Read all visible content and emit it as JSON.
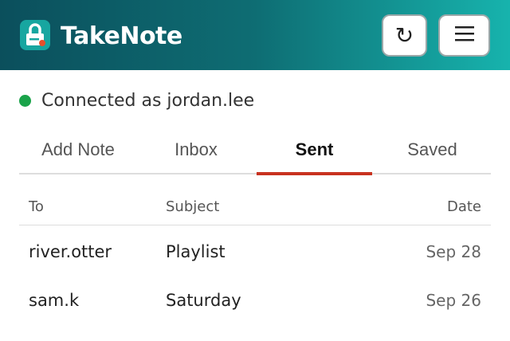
{
  "app": {
    "title": "TakeNote",
    "logo_icon": "lock-icon"
  },
  "header": {
    "refresh_glyph": "↻",
    "menu_icon": "hamburger-icon"
  },
  "status": {
    "text": "Connected as jordan.lee",
    "color": "#1aa34a"
  },
  "tabs": [
    {
      "label": "Add Note",
      "active": false
    },
    {
      "label": "Inbox",
      "active": false
    },
    {
      "label": "Sent",
      "active": true
    },
    {
      "label": "Saved",
      "active": false
    }
  ],
  "table": {
    "columns": [
      "To",
      "Subject",
      "Date"
    ],
    "rows": [
      {
        "to": "river.otter",
        "subject": "Playlist",
        "date": "Sep 28"
      },
      {
        "to": "sam.k",
        "subject": "Saturday",
        "date": "Sep 26"
      }
    ]
  },
  "colors": {
    "accent": "#c8321f",
    "header_start": "#0b4f5c",
    "header_end": "#17b3ad"
  }
}
